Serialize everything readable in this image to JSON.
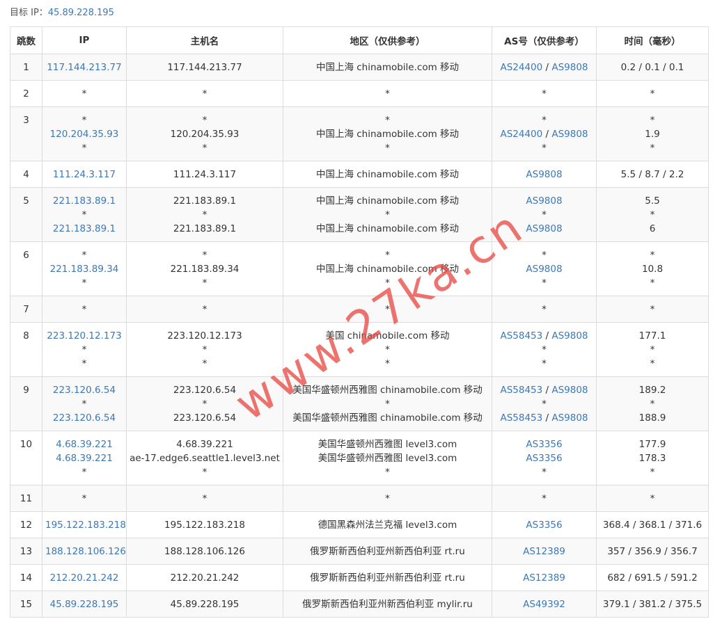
{
  "target": {
    "label": "目标 IP：",
    "ip": "45.89.228.195"
  },
  "headers": {
    "hop": "跳数",
    "ip": "IP",
    "host": "主机名",
    "region": "地区（仅供参考）",
    "as": "AS号（仅供参考）",
    "time": "时间（毫秒）"
  },
  "rows": [
    {
      "hop": "1",
      "ip": [
        "117.144.213.77"
      ],
      "host": [
        "117.144.213.77"
      ],
      "region": [
        "中国上海 chinamobile.com 移动"
      ],
      "as": [
        [
          "AS24400",
          "AS9808"
        ]
      ],
      "time": [
        "0.2 / 0.1 / 0.1"
      ]
    },
    {
      "hop": "2",
      "ip": [
        "*"
      ],
      "host": [
        "*"
      ],
      "region": [
        "*"
      ],
      "as": [
        [
          "*"
        ]
      ],
      "time": [
        "*"
      ]
    },
    {
      "hop": "3",
      "ip": [
        "*",
        "120.204.35.93",
        "*"
      ],
      "host": [
        "*",
        "120.204.35.93",
        "*"
      ],
      "region": [
        "*",
        "中国上海 chinamobile.com 移动",
        "*"
      ],
      "as": [
        [
          "*"
        ],
        [
          "AS24400",
          "AS9808"
        ],
        [
          "*"
        ]
      ],
      "time": [
        "*",
        "1.9",
        "*"
      ]
    },
    {
      "hop": "4",
      "ip": [
        "111.24.3.117"
      ],
      "host": [
        "111.24.3.117"
      ],
      "region": [
        "中国上海 chinamobile.com 移动"
      ],
      "as": [
        [
          "AS9808"
        ]
      ],
      "time": [
        "5.5 / 8.7 / 2.2"
      ]
    },
    {
      "hop": "5",
      "ip": [
        "221.183.89.1",
        "*",
        "221.183.89.1"
      ],
      "host": [
        "221.183.89.1",
        "*",
        "221.183.89.1"
      ],
      "region": [
        "中国上海 chinamobile.com 移动",
        "*",
        "中国上海 chinamobile.com 移动"
      ],
      "as": [
        [
          "AS9808"
        ],
        [
          "*"
        ],
        [
          "AS9808"
        ]
      ],
      "time": [
        "5.5",
        "*",
        "6"
      ]
    },
    {
      "hop": "6",
      "ip": [
        "*",
        "221.183.89.34",
        "*"
      ],
      "host": [
        "*",
        "221.183.89.34",
        "*"
      ],
      "region": [
        "*",
        "中国上海 chinamobile.com 移动",
        "*"
      ],
      "as": [
        [
          "*"
        ],
        [
          "AS9808"
        ],
        [
          "*"
        ]
      ],
      "time": [
        "*",
        "10.8",
        "*"
      ]
    },
    {
      "hop": "7",
      "ip": [
        "*"
      ],
      "host": [
        "*"
      ],
      "region": [
        "*"
      ],
      "as": [
        [
          "*"
        ]
      ],
      "time": [
        "*"
      ]
    },
    {
      "hop": "8",
      "ip": [
        "223.120.12.173",
        "*",
        "*"
      ],
      "host": [
        "223.120.12.173",
        "*",
        "*"
      ],
      "region": [
        "美国 chinamobile.com 移动",
        "*",
        "*"
      ],
      "as": [
        [
          "AS58453",
          "AS9808"
        ],
        [
          "*"
        ],
        [
          "*"
        ]
      ],
      "time": [
        "177.1",
        "*",
        "*"
      ]
    },
    {
      "hop": "9",
      "ip": [
        "223.120.6.54",
        "*",
        "223.120.6.54"
      ],
      "host": [
        "223.120.6.54",
        "*",
        "223.120.6.54"
      ],
      "region": [
        "美国华盛顿州西雅图 chinamobile.com 移动",
        "*",
        "美国华盛顿州西雅图 chinamobile.com 移动"
      ],
      "as": [
        [
          "AS58453",
          "AS9808"
        ],
        [
          "*"
        ],
        [
          "AS58453",
          "AS9808"
        ]
      ],
      "time": [
        "189.2",
        "*",
        "188.9"
      ]
    },
    {
      "hop": "10",
      "ip": [
        "4.68.39.221",
        "4.68.39.221",
        "*"
      ],
      "host": [
        "4.68.39.221",
        "ae-17.edge6.seattle1.level3.net",
        "*"
      ],
      "region": [
        "美国华盛顿州西雅图 level3.com",
        "美国华盛顿州西雅图 level3.com",
        "*"
      ],
      "as": [
        [
          "AS3356"
        ],
        [
          "AS3356"
        ],
        [
          "*"
        ]
      ],
      "time": [
        "177.9",
        "178.3",
        "*"
      ]
    },
    {
      "hop": "11",
      "ip": [
        "*"
      ],
      "host": [
        "*"
      ],
      "region": [
        "*"
      ],
      "as": [
        [
          "*"
        ]
      ],
      "time": [
        "*"
      ]
    },
    {
      "hop": "12",
      "ip": [
        "195.122.183.218"
      ],
      "host": [
        "195.122.183.218"
      ],
      "region": [
        "德国黑森州法兰克福 level3.com"
      ],
      "as": [
        [
          "AS3356"
        ]
      ],
      "time": [
        "368.4 / 368.1 / 371.6"
      ]
    },
    {
      "hop": "13",
      "ip": [
        "188.128.106.126"
      ],
      "host": [
        "188.128.106.126"
      ],
      "region": [
        "俄罗斯新西伯利亚州新西伯利亚 rt.ru"
      ],
      "as": [
        [
          "AS12389"
        ]
      ],
      "time": [
        "357 / 356.9 / 356.7"
      ]
    },
    {
      "hop": "14",
      "ip": [
        "212.20.21.242"
      ],
      "host": [
        "212.20.21.242"
      ],
      "region": [
        "俄罗斯新西伯利亚州新西伯利亚 rt.ru"
      ],
      "as": [
        [
          "AS12389"
        ]
      ],
      "time": [
        "682 / 691.5 / 591.2"
      ]
    },
    {
      "hop": "15",
      "ip": [
        "45.89.228.195"
      ],
      "host": [
        "45.89.228.195"
      ],
      "region": [
        "俄罗斯新西伯利亚州新西伯利亚 mylir.ru"
      ],
      "as": [
        [
          "AS49392"
        ]
      ],
      "time": [
        "379.1 / 381.2 / 375.5"
      ]
    }
  ],
  "watermark": "www.27ka.cn",
  "colors": {
    "link": "#3a78b8",
    "watermark": "#e84c46",
    "border": "#dcdcdc",
    "stripe": "#f9f9f9"
  }
}
